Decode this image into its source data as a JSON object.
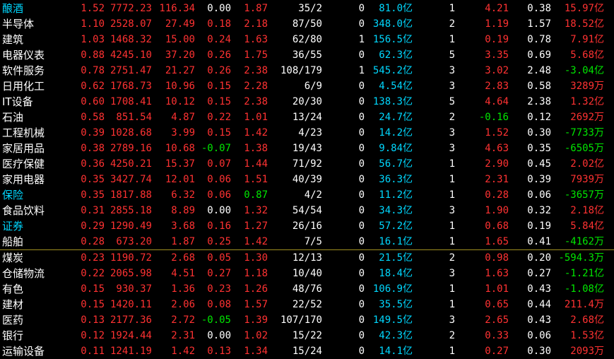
{
  "divider_after_row": 15,
  "colors": {
    "up": "#ff3232",
    "down": "#00e600",
    "name_default": "#ffffff",
    "name_highlight": "#00d8ff",
    "amount": "#00d8ff",
    "divider": "#a09020"
  },
  "rows": [
    {
      "name": "酿酒",
      "name_hl": true,
      "v1": "1.52",
      "v2": "7772.23",
      "v3": "116.34",
      "v4": "0.00",
      "v4c": "white",
      "v5": "1.87",
      "v5c": "up",
      "v6": "35/2",
      "v7": "0",
      "amt": "81.0",
      "amt_unit": "亿",
      "v9": "1",
      "v10": "4.21",
      "v10c": "up",
      "v11": "0.38",
      "net": "15.97",
      "net_unit": "亿",
      "netc": "up"
    },
    {
      "name": "半导体",
      "name_hl": false,
      "v1": "1.10",
      "v2": "2528.07",
      "v3": "27.49",
      "v4": "0.18",
      "v4c": "up",
      "v5": "2.18",
      "v5c": "up",
      "v6": "87/50",
      "v7": "0",
      "amt": "348.0",
      "amt_unit": "亿",
      "v9": "2",
      "v10": "1.19",
      "v10c": "up",
      "v11": "1.57",
      "net": "18.52",
      "net_unit": "亿",
      "netc": "up"
    },
    {
      "name": "建筑",
      "name_hl": false,
      "v1": "1.03",
      "v2": "1468.32",
      "v3": "15.00",
      "v4": "0.24",
      "v4c": "up",
      "v5": "1.63",
      "v5c": "up",
      "v6": "62/80",
      "v7": "1",
      "amt": "156.5",
      "amt_unit": "亿",
      "v9": "1",
      "v10": "0.19",
      "v10c": "up",
      "v11": "0.78",
      "net": "7.91",
      "net_unit": "亿",
      "netc": "up"
    },
    {
      "name": "电器仪表",
      "name_hl": false,
      "v1": "0.88",
      "v2": "4245.10",
      "v3": "37.20",
      "v4": "0.26",
      "v4c": "up",
      "v5": "1.75",
      "v5c": "up",
      "v6": "36/55",
      "v7": "0",
      "amt": "62.3",
      "amt_unit": "亿",
      "v9": "5",
      "v10": "3.35",
      "v10c": "up",
      "v11": "0.69",
      "net": "5.68",
      "net_unit": "亿",
      "netc": "up"
    },
    {
      "name": "软件服务",
      "name_hl": false,
      "v1": "0.78",
      "v2": "2751.47",
      "v3": "21.27",
      "v4": "0.26",
      "v4c": "up",
      "v5": "2.38",
      "v5c": "up",
      "v6": "108/179",
      "v7": "1",
      "amt": "545.2",
      "amt_unit": "亿",
      "v9": "3",
      "v10": "3.02",
      "v10c": "up",
      "v11": "2.48",
      "net": "-3.04",
      "net_unit": "亿",
      "netc": "down"
    },
    {
      "name": "日用化工",
      "name_hl": false,
      "v1": "0.62",
      "v2": "1768.73",
      "v3": "10.96",
      "v4": "0.15",
      "v4c": "up",
      "v5": "2.28",
      "v5c": "up",
      "v6": "6/9",
      "v7": "0",
      "amt": "4.54",
      "amt_unit": "亿",
      "v9": "3",
      "v10": "2.83",
      "v10c": "up",
      "v11": "0.58",
      "net": "3289",
      "net_unit": "万",
      "netc": "up"
    },
    {
      "name": "IT设备",
      "name_hl": false,
      "v1": "0.60",
      "v2": "1708.41",
      "v3": "10.12",
      "v4": "0.15",
      "v4c": "up",
      "v5": "2.38",
      "v5c": "up",
      "v6": "20/30",
      "v7": "0",
      "amt": "138.3",
      "amt_unit": "亿",
      "v9": "5",
      "v10": "4.64",
      "v10c": "up",
      "v11": "2.38",
      "net": "1.32",
      "net_unit": "亿",
      "netc": "up"
    },
    {
      "name": "石油",
      "name_hl": false,
      "v1": "0.58",
      "v2": "851.54",
      "v3": "4.87",
      "v4": "0.22",
      "v4c": "up",
      "v5": "1.01",
      "v5c": "up",
      "v6": "13/24",
      "v7": "0",
      "amt": "24.7",
      "amt_unit": "亿",
      "v9": "2",
      "v10": "-0.16",
      "v10c": "down",
      "v11": "0.12",
      "net": "2692",
      "net_unit": "万",
      "netc": "up"
    },
    {
      "name": "工程机械",
      "name_hl": false,
      "v1": "0.39",
      "v2": "1028.68",
      "v3": "3.99",
      "v4": "0.15",
      "v4c": "up",
      "v5": "1.42",
      "v5c": "up",
      "v6": "4/23",
      "v7": "0",
      "amt": "14.2",
      "amt_unit": "亿",
      "v9": "3",
      "v10": "1.52",
      "v10c": "up",
      "v11": "0.30",
      "net": "-7733",
      "net_unit": "万",
      "netc": "down"
    },
    {
      "name": "家居用品",
      "name_hl": false,
      "v1": "0.38",
      "v2": "2789.16",
      "v3": "10.68",
      "v4": "-0.07",
      "v4c": "down",
      "v5": "1.38",
      "v5c": "up",
      "v6": "19/43",
      "v7": "0",
      "amt": "9.84",
      "amt_unit": "亿",
      "v9": "3",
      "v10": "4.63",
      "v10c": "up",
      "v11": "0.35",
      "net": "-6505",
      "net_unit": "万",
      "netc": "down"
    },
    {
      "name": "医疗保健",
      "name_hl": false,
      "v1": "0.36",
      "v2": "4250.21",
      "v3": "15.37",
      "v4": "0.07",
      "v4c": "up",
      "v5": "1.44",
      "v5c": "up",
      "v6": "71/92",
      "v7": "0",
      "amt": "56.7",
      "amt_unit": "亿",
      "v9": "1",
      "v10": "2.90",
      "v10c": "up",
      "v11": "0.45",
      "net": "2.02",
      "net_unit": "亿",
      "netc": "up"
    },
    {
      "name": "家用电器",
      "name_hl": false,
      "v1": "0.35",
      "v2": "3427.74",
      "v3": "12.01",
      "v4": "0.06",
      "v4c": "up",
      "v5": "1.51",
      "v5c": "up",
      "v6": "40/39",
      "v7": "0",
      "amt": "36.3",
      "amt_unit": "亿",
      "v9": "1",
      "v10": "2.31",
      "v10c": "up",
      "v11": "0.39",
      "net": "7939",
      "net_unit": "万",
      "netc": "up"
    },
    {
      "name": "保险",
      "name_hl": true,
      "v1": "0.35",
      "v2": "1817.88",
      "v3": "6.32",
      "v4": "0.06",
      "v4c": "up",
      "v5": "0.87",
      "v5c": "down",
      "v6": "4/2",
      "v7": "0",
      "amt": "11.2",
      "amt_unit": "亿",
      "v9": "1",
      "v10": "0.28",
      "v10c": "up",
      "v11": "0.06",
      "net": "-3657",
      "net_unit": "万",
      "netc": "down"
    },
    {
      "name": "食品饮料",
      "name_hl": false,
      "v1": "0.31",
      "v2": "2855.18",
      "v3": "8.89",
      "v4": "0.00",
      "v4c": "white",
      "v5": "1.32",
      "v5c": "up",
      "v6": "54/54",
      "v7": "0",
      "amt": "34.3",
      "amt_unit": "亿",
      "v9": "3",
      "v10": "1.90",
      "v10c": "up",
      "v11": "0.32",
      "net": "2.18",
      "net_unit": "亿",
      "netc": "up"
    },
    {
      "name": "证券",
      "name_hl": true,
      "v1": "0.29",
      "v2": "1290.49",
      "v3": "3.68",
      "v4": "0.16",
      "v4c": "up",
      "v5": "1.27",
      "v5c": "up",
      "v6": "26/16",
      "v7": "0",
      "amt": "57.2",
      "amt_unit": "亿",
      "v9": "1",
      "v10": "0.68",
      "v10c": "up",
      "v11": "0.19",
      "net": "5.84",
      "net_unit": "亿",
      "netc": "up"
    },
    {
      "name": "船舶",
      "name_hl": false,
      "v1": "0.28",
      "v2": "673.20",
      "v3": "1.87",
      "v4": "0.25",
      "v4c": "up",
      "v5": "1.42",
      "v5c": "up",
      "v6": "7/5",
      "v7": "0",
      "amt": "16.1",
      "amt_unit": "亿",
      "v9": "1",
      "v10": "1.65",
      "v10c": "up",
      "v11": "0.41",
      "net": "-4162",
      "net_unit": "万",
      "netc": "down"
    },
    {
      "name": "煤炭",
      "name_hl": false,
      "v1": "0.23",
      "v2": "1190.72",
      "v3": "2.68",
      "v4": "0.05",
      "v4c": "up",
      "v5": "1.30",
      "v5c": "up",
      "v6": "12/13",
      "v7": "0",
      "amt": "21.5",
      "amt_unit": "亿",
      "v9": "2",
      "v10": "0.98",
      "v10c": "up",
      "v11": "0.20",
      "net": "-594.3",
      "net_unit": "万",
      "netc": "down"
    },
    {
      "name": "仓储物流",
      "name_hl": false,
      "v1": "0.22",
      "v2": "2065.98",
      "v3": "4.51",
      "v4": "0.27",
      "v4c": "up",
      "v5": "1.18",
      "v5c": "up",
      "v6": "10/40",
      "v7": "0",
      "amt": "18.4",
      "amt_unit": "亿",
      "v9": "3",
      "v10": "1.63",
      "v10c": "up",
      "v11": "0.27",
      "net": "-1.21",
      "net_unit": "亿",
      "netc": "down"
    },
    {
      "name": "有色",
      "name_hl": false,
      "v1": "0.15",
      "v2": "930.37",
      "v3": "1.36",
      "v4": "0.23",
      "v4c": "up",
      "v5": "1.26",
      "v5c": "up",
      "v6": "48/76",
      "v7": "0",
      "amt": "106.9",
      "amt_unit": "亿",
      "v9": "1",
      "v10": "1.01",
      "v10c": "up",
      "v11": "0.43",
      "net": "-1.08",
      "net_unit": "亿",
      "netc": "down"
    },
    {
      "name": "建材",
      "name_hl": false,
      "v1": "0.15",
      "v2": "1420.11",
      "v3": "2.06",
      "v4": "0.08",
      "v4c": "up",
      "v5": "1.57",
      "v5c": "up",
      "v6": "22/52",
      "v7": "0",
      "amt": "35.5",
      "amt_unit": "亿",
      "v9": "1",
      "v10": "0.65",
      "v10c": "up",
      "v11": "0.44",
      "net": "211.4",
      "net_unit": "万",
      "netc": "up"
    },
    {
      "name": "医药",
      "name_hl": false,
      "v1": "0.13",
      "v2": "2177.36",
      "v3": "2.72",
      "v4": "-0.05",
      "v4c": "down",
      "v5": "1.39",
      "v5c": "up",
      "v6": "107/170",
      "v7": "0",
      "amt": "149.5",
      "amt_unit": "亿",
      "v9": "3",
      "v10": "2.65",
      "v10c": "up",
      "v11": "0.43",
      "net": "2.68",
      "net_unit": "亿",
      "netc": "up"
    },
    {
      "name": "银行",
      "name_hl": false,
      "v1": "0.12",
      "v2": "1924.44",
      "v3": "2.31",
      "v4": "0.00",
      "v4c": "white",
      "v5": "1.02",
      "v5c": "up",
      "v6": "15/22",
      "v7": "0",
      "amt": "42.3",
      "amt_unit": "亿",
      "v9": "2",
      "v10": "0.33",
      "v10c": "up",
      "v11": "0.06",
      "net": "1.53",
      "net_unit": "亿",
      "netc": "up"
    },
    {
      "name": "运输设备",
      "name_hl": false,
      "v1": "0.11",
      "v2": "1241.19",
      "v3": "1.42",
      "v4": "0.13",
      "v4c": "up",
      "v5": "1.34",
      "v5c": "up",
      "v6": "15/24",
      "v7": "0",
      "amt": "14.1",
      "amt_unit": "亿",
      "v9": "1",
      "v10": "0.27",
      "v10c": "up",
      "v11": "0.30",
      "net": "2093",
      "net_unit": "万",
      "netc": "up"
    }
  ]
}
